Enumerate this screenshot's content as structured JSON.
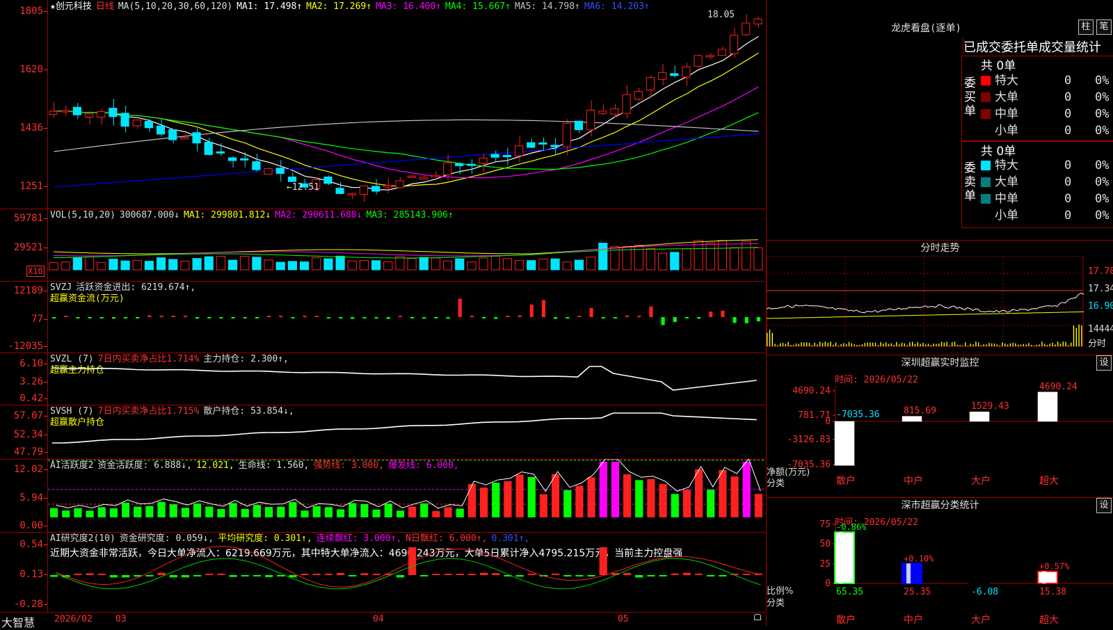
{
  "stock": {
    "name": "创元科技",
    "period": "日线",
    "star": "★"
  },
  "colors": {
    "up": "#ff2020",
    "down": "#00e5ff",
    "border": "#a00000",
    "tick": "#ff3030",
    "ma1": "#ffffff",
    "ma2": "#ffff00",
    "ma3": "#ff00ff",
    "ma4": "#00ff00",
    "ma5": "#c0c0c0",
    "ma6": "#0000ff"
  },
  "main_header": {
    "ma": "MA(5,10,20,30,60,120)",
    "ma1": "MA1: 17.498↑",
    "ma2": "MA2: 17.269↑",
    "ma3": "MA3: 16.400↑",
    "ma4": "MA4: 15.667↑",
    "ma5": "MA5: 14.798↑",
    "ma6": "MA6: 14.203↑"
  },
  "main_axis": [
    "1805",
    "1620",
    "1436",
    "1251"
  ],
  "main_annot": {
    "high": "18.05",
    "low": "12.51"
  },
  "vol_header": {
    "name": "VOL(5,10,20)",
    "val": "300687.000↓",
    "ma1": "MA1: 299801.812↓",
    "ma2": "MA2: 290611.688↓",
    "ma3": "MA3: 285143.906↑"
  },
  "vol_axis": [
    "59781",
    "29521"
  ],
  "vol_unit": "X10",
  "svzj": {
    "name": "SVZJ",
    "label": "活跃资金进出: 6219.674↑,",
    "sub": "超赢资金流(万元)",
    "axis": [
      "12189",
      "77",
      "-12035"
    ]
  },
  "svzl": {
    "name": "SVZL (7)",
    "pct": "7日内买卖净占比1.714%",
    "label": "主力持仓: 2.300↑,",
    "sub": "超赢主力持仓",
    "axis": [
      "6.10",
      "3.26",
      "0.42"
    ]
  },
  "svsh": {
    "name": "SVSH (7)",
    "pct": "7日内买卖净占比1.715%",
    "label": "散户持仓: 53.854↓,",
    "sub": "超赢散户持仓",
    "axis": [
      "57.07",
      "52.34",
      "47.79"
    ]
  },
  "ai1": {
    "name": "AI活跃度2",
    "a": "资金活跃度: 6.888↓,",
    "b": "12.021,",
    "c": "生命线: 1.560,",
    "d": "强势线: 3.000,",
    "e": "爆发线: 6.000,",
    "axis": [
      "12.02",
      "5.94",
      "0.00"
    ]
  },
  "ai2": {
    "name": "AI研究度2(10)",
    "a": "资金研究度: 0.059↓,",
    "b": "平均研究度: 0.301↑,",
    "c": "连续飘红: 3.000↑,",
    "d": "N日飘红: 6.000↑,",
    "e": "0.301↑,",
    "note": "近期大资金非常活跃，今日大单净流入：6219.669万元，其中特大单净流入：4690.243万元，大单5日累计净入4795.215万元，当前主力控盘强",
    "axis": [
      "0.54",
      "0.13",
      "-0.28"
    ]
  },
  "bottom": {
    "brand": "大智慧",
    "dates": [
      "2026/02",
      "03",
      "04",
      "05"
    ]
  },
  "lhb": {
    "title": "龙虎看盘(逐单)",
    "btn1": "柱",
    "btn2": "笔",
    "tabs": "已成交委托单成交量统计",
    "buy_label": "委买单",
    "sell_label": "委卖单",
    "buy_total": "共 0单",
    "sell_total": "共 0单",
    "rows": [
      {
        "name": "特大",
        "v": "0",
        "p": "0%"
      },
      {
        "name": "大单",
        "v": "0",
        "p": "0%"
      },
      {
        "name": "中单",
        "v": "0",
        "p": "0%"
      },
      {
        "name": "小单",
        "v": "0",
        "p": "0%"
      }
    ]
  },
  "fenshi": {
    "title": "分时走势",
    "axis": [
      "17.78",
      "17.34",
      "16.90"
    ],
    "vol": "14444",
    "vol_unit": "分时"
  },
  "monitor": {
    "title": "深圳超赢实时监控",
    "btn": "设",
    "time": "时间: 2026/05/22",
    "axis": [
      "4690.24",
      "781.71",
      "0",
      "-3126.83",
      "-7035.36"
    ],
    "ylabel": "净额(万元)",
    "xlabel": "分类",
    "cats": [
      "散户",
      "中户",
      "大户",
      "超大"
    ],
    "values": [
      -7035.36,
      815.69,
      1529.43,
      4690.24
    ],
    "labels": [
      "-7035.36",
      "815.69",
      "1529.43",
      "4690.24"
    ]
  },
  "classify": {
    "title": "深市超赢分类统计",
    "btn": "设",
    "time": "时间: 2026/05/22",
    "axis": [
      "75",
      "50",
      "25",
      "0"
    ],
    "ylabel": "比例%",
    "xlabel": "分类",
    "cats": [
      "散户",
      "中户",
      "大户",
      "超大"
    ],
    "values": [
      65.35,
      25.35,
      -6.08,
      15.38
    ],
    "values_label": [
      "65.35",
      "25.35",
      "-6.08",
      "15.38"
    ],
    "changes": [
      "-0.86%",
      "+0.10%",
      "",
      "+0.57%"
    ]
  }
}
